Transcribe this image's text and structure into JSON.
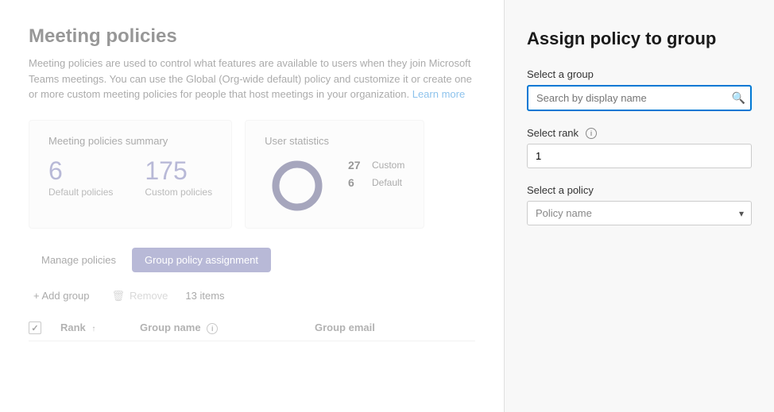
{
  "page": {
    "title": "Meeting policies",
    "description": "Meeting policies are used to control what features are available to users when they join Microsoft Teams meetings. You can use the Global (Org-wide default) policy and customize it or create one or more custom meeting policies for people that host meetings in your organization.",
    "learn_more": "Learn more"
  },
  "summary": {
    "section_title": "Meeting policies summary",
    "default_count": "6",
    "default_label": "Default policies",
    "custom_count": "175",
    "custom_label": "Custom policies"
  },
  "user_stats": {
    "section_title": "User statistics",
    "custom_count": "27",
    "custom_label": "Custom",
    "default_count": "6",
    "default_label": "Default"
  },
  "tabs": [
    {
      "id": "manage",
      "label": "Manage policies",
      "active": false
    },
    {
      "id": "group",
      "label": "Group policy assignment",
      "active": true
    }
  ],
  "toolbar": {
    "add_label": "+ Add group",
    "remove_label": "Remove",
    "items_count": "13 items"
  },
  "table": {
    "col_rank": "Rank",
    "col_group_name": "Group name",
    "col_group_email": "Group email"
  },
  "right_panel": {
    "title": "Assign policy to group",
    "select_group_label": "Select a group",
    "search_placeholder": "Search by display name",
    "select_rank_label": "Select rank",
    "rank_info_icon": "ℹ",
    "rank_value": "1",
    "select_policy_label": "Select a policy",
    "policy_placeholder": "Policy name"
  },
  "colors": {
    "accent": "#6264a7",
    "active_tab_bg": "#6264a7",
    "active_tab_text": "#ffffff",
    "link": "#0078d4",
    "border_focus": "#0078d4"
  }
}
